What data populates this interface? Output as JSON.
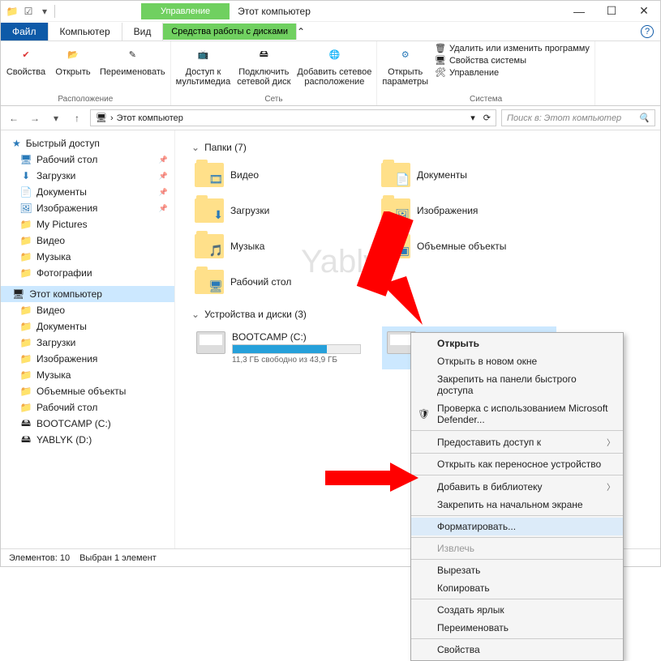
{
  "title": "Этот компьютер",
  "manage_tab": "Управление",
  "tabs": {
    "file": "Файл",
    "computer": "Компьютер",
    "view": "Вид",
    "drive_tools": "Средства работы с дисками"
  },
  "ribbon": {
    "loc": {
      "props": "Свойства",
      "open": "Открыть",
      "rename": "Переименовать",
      "group": "Расположение"
    },
    "net": {
      "media": "Доступ к\nмультимедиа",
      "netdrive": "Подключить\nсетевой диск",
      "netloc": "Добавить сетевое\nрасположение",
      "group": "Сеть"
    },
    "sys": {
      "params": "Открыть\nпараметры",
      "uninstall": "Удалить или изменить программу",
      "sysprops": "Свойства системы",
      "manage": "Управление",
      "group": "Система"
    }
  },
  "address": "Этот компьютер",
  "search_placeholder": "Поиск в: Этот компьютер",
  "sidebar": {
    "quick": "Быстрый доступ",
    "items1": [
      "Рабочий стол",
      "Загрузки",
      "Документы",
      "Изображения",
      "My Pictures",
      "Видео",
      "Музыка",
      "Фотографии"
    ],
    "thispc": "Этот компьютер",
    "items2": [
      "Видео",
      "Документы",
      "Загрузки",
      "Изображения",
      "Музыка",
      "Объемные объекты",
      "Рабочий стол",
      "BOOTCAMP (C:)",
      "YABLYK (D:)"
    ]
  },
  "groups": {
    "folders": {
      "title": "Папки (7)",
      "items": [
        "Видео",
        "Документы",
        "Загрузки",
        "Изображения",
        "Музыка",
        "Объемные объекты",
        "Рабочий стол"
      ]
    },
    "drives": {
      "title": "Устройства и диски (3)",
      "c": {
        "name": "BOOTCAMP (C:)",
        "free": "11,3 ГБ свободно из 43,9 ГБ",
        "pct": 74
      },
      "d": {
        "name": "YABLYK (D:)"
      }
    }
  },
  "ctx": {
    "open": "Открыть",
    "open_new": "Открыть в новом окне",
    "pin_quick": "Закрепить на панели быстрого доступа",
    "defender": "Проверка с использованием Microsoft Defender...",
    "share": "Предоставить доступ к",
    "portable": "Открыть как переносное устройство",
    "library": "Добавить в библиотеку",
    "pin_start": "Закрепить на начальном экране",
    "format": "Форматировать...",
    "eject": "Извлечь",
    "cut": "Вырезать",
    "copy": "Копировать",
    "shortcut": "Создать ярлык",
    "rename": "Переименовать",
    "props": "Свойства"
  },
  "status": {
    "count": "Элементов: 10",
    "sel": "Выбран 1 элемент"
  },
  "watermark": "Yablyk"
}
